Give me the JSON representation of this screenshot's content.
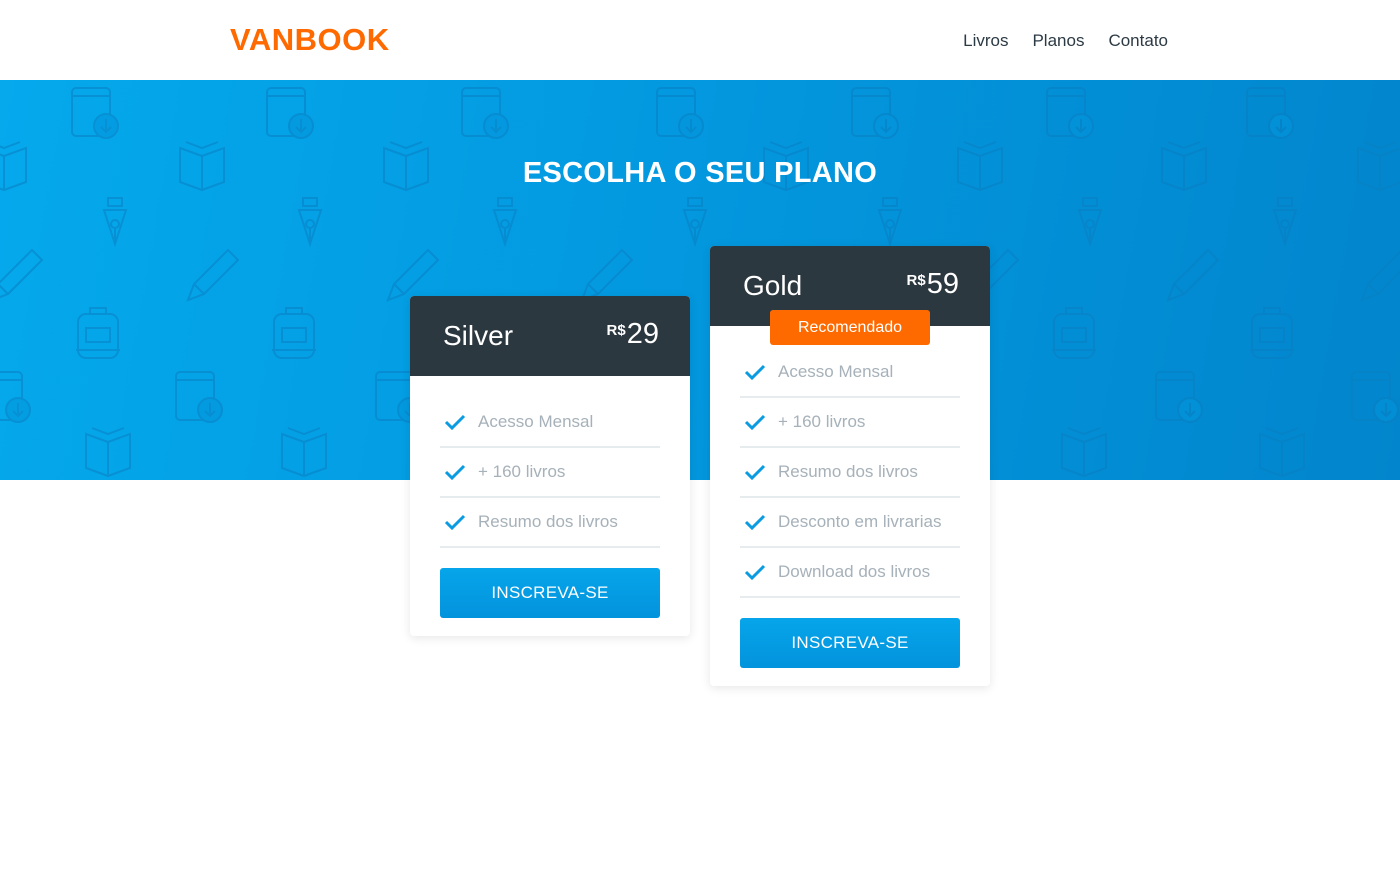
{
  "header": {
    "logo": "VANBOOK",
    "nav": [
      "Livros",
      "Planos",
      "Contato"
    ]
  },
  "hero": {
    "title": "ESCOLHA O SEU PLANO"
  },
  "plans": [
    {
      "name": "Silver",
      "currency": "R$",
      "price": "29",
      "features": [
        "Acesso Mensal",
        "+ 160 livros",
        "Resumo dos livros"
      ],
      "cta": "INSCREVA-SE"
    },
    {
      "name": "Gold",
      "currency": "R$",
      "price": "59",
      "badge": "Recomendado",
      "features": [
        "Acesso Mensal",
        "+ 160 livros",
        "Resumo dos livros",
        "Desconto em livrarias",
        "Download dos livros"
      ],
      "cta": "INSCREVA-SE"
    }
  ],
  "colors": {
    "brand": "#ff6a00",
    "hero_blue": "#0399e0",
    "card_header": "#2c3840",
    "check": "#0a9be0",
    "feature_text": "#a6b1b9"
  },
  "icons": [
    "book-download-icon",
    "open-book-icon",
    "pen-nib-icon",
    "pencil-icon",
    "backpack-icon",
    "check-icon"
  ]
}
